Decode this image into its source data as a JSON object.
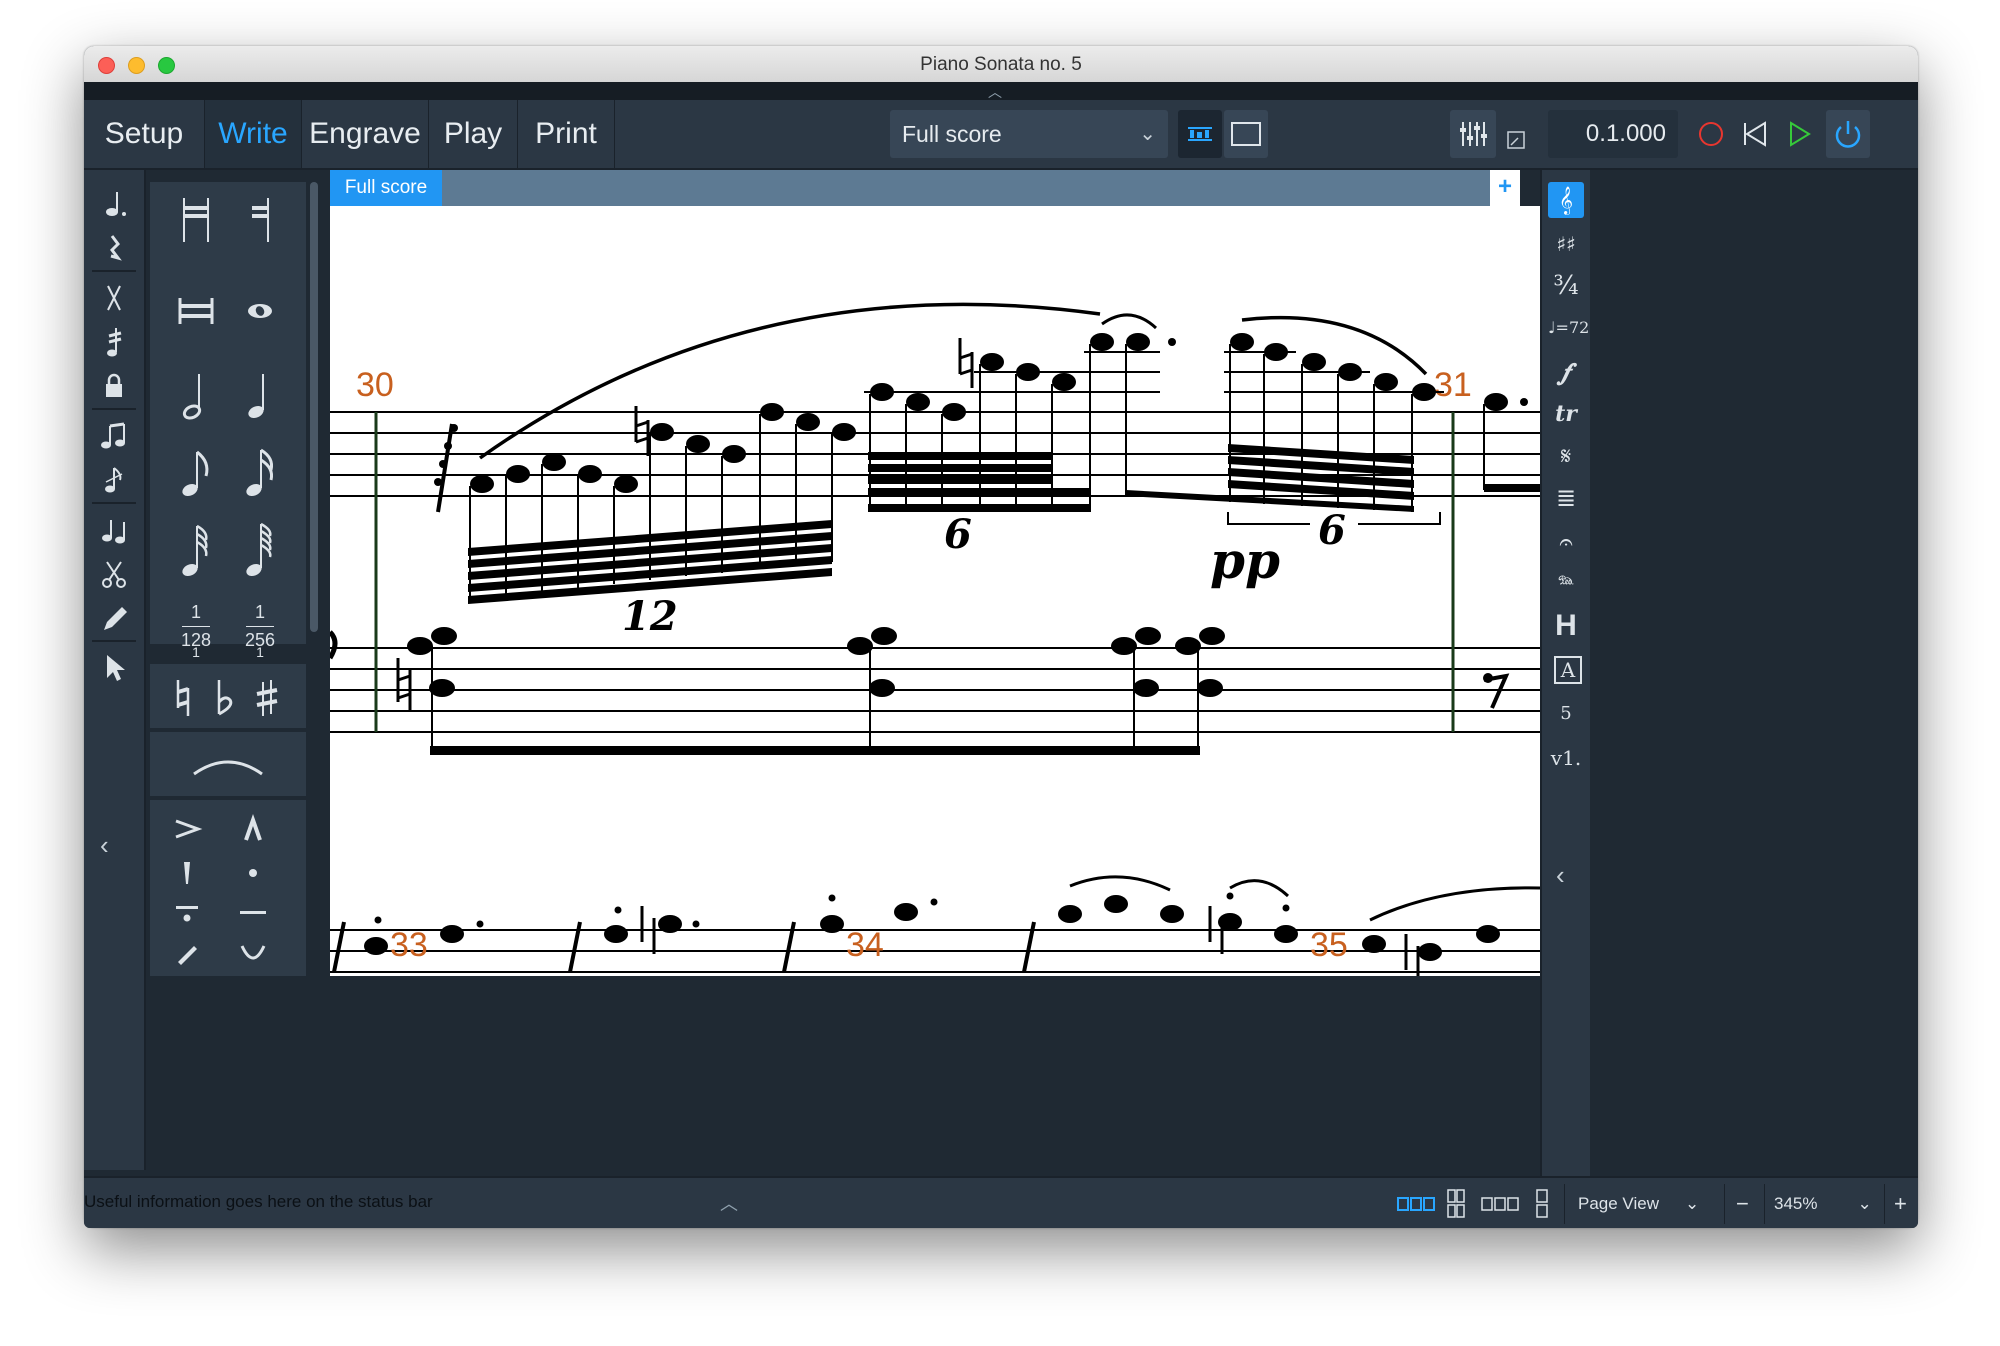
{
  "window": {
    "title": "Piano Sonata no. 5"
  },
  "modes": [
    {
      "label": "Setup",
      "active": false
    },
    {
      "label": "Write",
      "active": true
    },
    {
      "label": "Engrave",
      "active": false
    },
    {
      "label": "Play",
      "active": false
    },
    {
      "label": "Print",
      "active": false
    }
  ],
  "toolbar": {
    "layout_selected": "Full score",
    "timecode": "0.1.000"
  },
  "left_toolbox": [
    "note-input-icon",
    "rest-icon",
    "slash-icon",
    "tremolo-icon",
    "lock-duration-icon",
    "chord-icon",
    "grace-note-icon",
    "insert-icon",
    "scissors-icon",
    "pencil-icon",
    "select-arrow-icon"
  ],
  "notes_panel": {
    "durations": [
      "breve",
      "whole",
      "half",
      "quarter",
      "eighth",
      "16th",
      "32nd",
      "64th"
    ],
    "tiny": [
      {
        "num": "1",
        "den": "128"
      },
      {
        "num": "1",
        "den": "256"
      }
    ],
    "partial": [
      "1",
      "1"
    ],
    "accidentals": [
      "natural",
      "flat",
      "sharp"
    ],
    "articulations": [
      "accent",
      "marcato",
      "staccatissimo",
      "staccato",
      "tenuto-staccato",
      "tenuto",
      "stress",
      "unstress"
    ]
  },
  "tabs": [
    {
      "label": "Full score",
      "active": true
    }
  ],
  "tabs_add": "+",
  "score": {
    "bar_numbers": [
      "30",
      "31",
      "33",
      "34",
      "35"
    ],
    "tuplets": [
      "12",
      "6",
      "6"
    ],
    "dynamic": "pp"
  },
  "right_panel": [
    {
      "name": "clefs",
      "glyph": "𝄞",
      "active": true
    },
    {
      "name": "key-signatures",
      "glyph": "♯♯"
    },
    {
      "name": "time-signatures",
      "glyph": "¾"
    },
    {
      "name": "tempo",
      "glyph": "♩=72"
    },
    {
      "name": "dynamics",
      "glyph": "𝆑"
    },
    {
      "name": "ornaments",
      "glyph": "tr"
    },
    {
      "name": "repeats",
      "glyph": "𝄋"
    },
    {
      "name": "bars",
      "glyph": "≣"
    },
    {
      "name": "holds-pauses",
      "glyph": "𝄐"
    },
    {
      "name": "pedal",
      "glyph": "𝆮"
    },
    {
      "name": "chord-symbols",
      "glyph": "H"
    },
    {
      "name": "text",
      "glyph": "A"
    },
    {
      "name": "fingering",
      "glyph": "5"
    },
    {
      "name": "version",
      "glyph": "v1."
    }
  ],
  "statusbar": {
    "text": "Useful information goes here on the status bar",
    "view_mode": "Page View",
    "zoom": "345%",
    "minus": "−",
    "plus": "+"
  },
  "colors": {
    "accent": "#2196f3",
    "bar_number": "#c8601f",
    "record": "#e8362f",
    "play": "#36c93a",
    "chrome": "#2b3744"
  }
}
